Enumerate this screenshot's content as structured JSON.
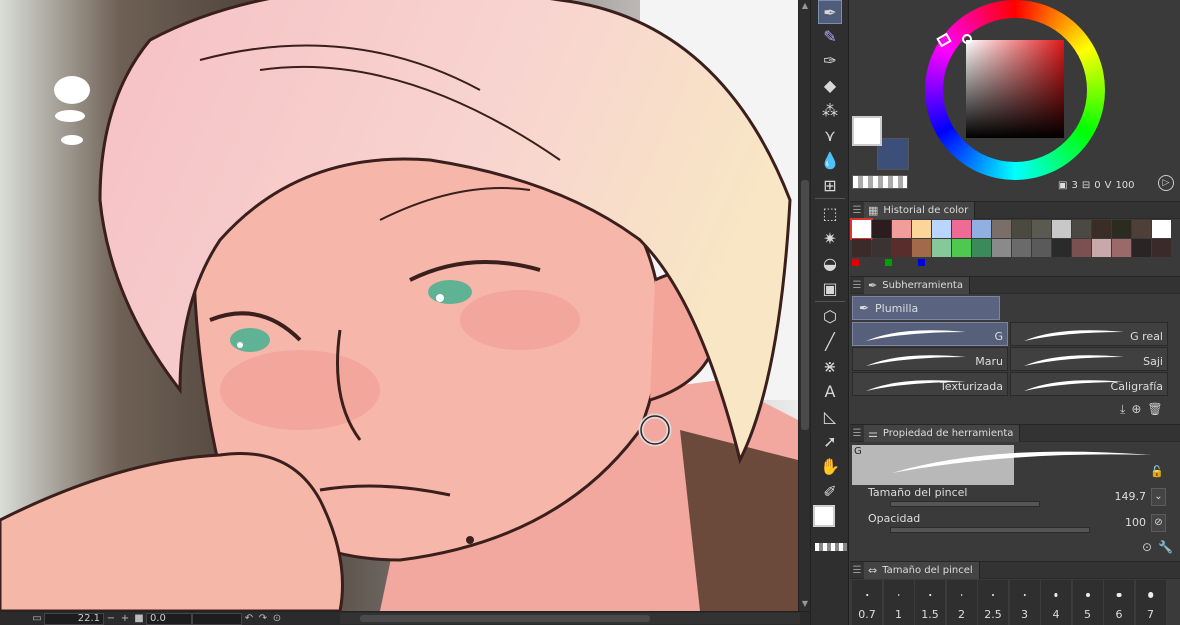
{
  "canvas": {
    "zoom": "22.1",
    "rotation": "0.0"
  },
  "color": {
    "main": "#ffffff",
    "sub": "#3c4f78",
    "hue_square_base": "#e0191b",
    "info": {
      "a": "3",
      "b": "0",
      "c": "100"
    }
  },
  "color_history": {
    "title": "Historial de color",
    "swatches": [
      "#ffffff",
      "#2b1d1d",
      "#f39c9c",
      "#fbd59a",
      "#b8d6ff",
      "#f06a96",
      "#8fb0e0",
      "#7a6f68",
      "#4a4a40",
      "#5a5a50",
      "#c8c8c8",
      "#4a4a42",
      "#3a2d25",
      "#2b2b20",
      "#4e3f38",
      "#ffffff",
      "#3a2a2a",
      "#3a3332",
      "#5a2d2d",
      "#a36a4a",
      "#86c89a",
      "#4ec84e",
      "#3a8a5a",
      "#8a8a8a",
      "#6a6a6a",
      "#5a5a5a",
      "#2a2a2a",
      "#7a5050",
      "#c8a8a8",
      "#9a6a6a",
      "#2a2424",
      "#3a2a2a"
    ],
    "marks": [
      "#e00000",
      "#00a000",
      "#0000e0"
    ]
  },
  "subtool": {
    "title": "Subherramienta",
    "group": "Plumilla",
    "brushes": [
      "G",
      "G real",
      "Maru",
      "Saji",
      "Texturizada",
      "Caligrafía"
    ]
  },
  "tool_property": {
    "title": "Propiedad de herramienta",
    "preview_letter": "G",
    "brush_size_label": "Tamaño del pincel",
    "brush_size_value": "149.7",
    "opacity_label": "Opacidad",
    "opacity_value": "100"
  },
  "brush_size_panel": {
    "title": "Tamaño del pincel",
    "sizes": [
      "0.7",
      "1",
      "1.5",
      "2",
      "2.5",
      "3",
      "4",
      "5",
      "6",
      "7"
    ]
  },
  "tools": [
    "pen-tool",
    "marker-tool",
    "vector-pen-tool",
    "eraser-tool",
    "decoration-tool",
    "blend-tool",
    "fill-tool",
    "ruler-tool",
    "selection-tool",
    "magic-wand-tool",
    "bucket-tool",
    "gradient-tool",
    "figure-3d-tool",
    "line-tool",
    "pattern-tool",
    "text-tool",
    "frame-tool",
    "operation-tool",
    "hand-tool",
    "eyedropper-tool"
  ]
}
